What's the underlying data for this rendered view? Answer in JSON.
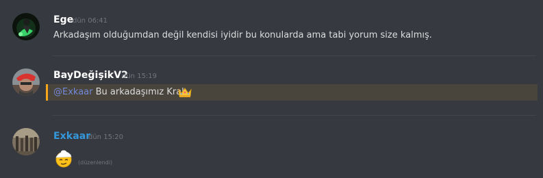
{
  "messages": [
    {
      "author": "Ege",
      "timestamp": "dün 06:41",
      "content": "Arkadaşım olduğumdan değil kendisi iyidir bu konularda ama tabi yorum size kalmış."
    },
    {
      "author": "BayDeğişikV2",
      "timestamp": "dün 15:19",
      "mention": "@Exkaar",
      "content": "Bu arkadaşımız Kral",
      "emoji": "crown-emoji"
    },
    {
      "author": "Exkaar",
      "author_color": "#3498db",
      "timestamp": "dün 15:20",
      "emoji": "emoji-face-with-cap",
      "edited_label": "(düzenlendi)"
    }
  ],
  "colors": {
    "background": "#36393f",
    "mention_highlight": "#49443c",
    "mention_bar": "#faa61a",
    "mention_text": "#7289da"
  }
}
